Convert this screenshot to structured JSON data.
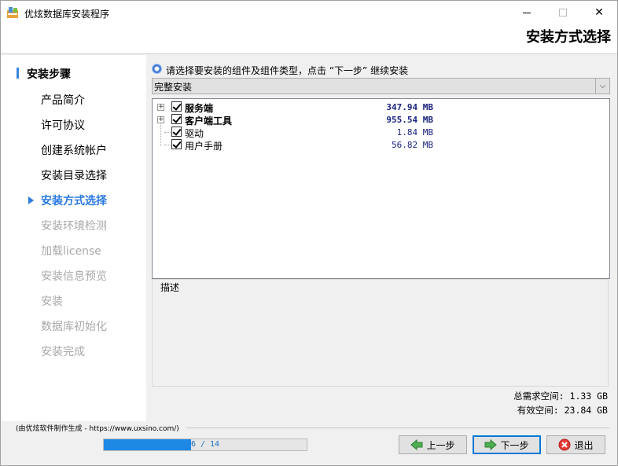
{
  "window": {
    "title": "优炫数据库安装程序",
    "header_title": "安装方式选择"
  },
  "sidebar": {
    "heading": "安装步骤",
    "steps": [
      {
        "label": "产品简介",
        "state": "done"
      },
      {
        "label": "许可协议",
        "state": "done"
      },
      {
        "label": "创建系统帐户",
        "state": "done"
      },
      {
        "label": "安装目录选择",
        "state": "done"
      },
      {
        "label": "安装方式选择",
        "state": "current"
      },
      {
        "label": "安装环境检测",
        "state": "pending"
      },
      {
        "label": "加载license",
        "state": "pending"
      },
      {
        "label": "安装信息预览",
        "state": "pending"
      },
      {
        "label": "安装",
        "state": "pending"
      },
      {
        "label": "数据库初始化",
        "state": "pending"
      },
      {
        "label": "安装完成",
        "state": "pending"
      }
    ]
  },
  "main": {
    "instruction": "请选择要安装的组件及组件类型，点击 “下一步” 继续安装",
    "install_type": "完整安装",
    "components": [
      {
        "label": "服务端",
        "size": "347.94 MB",
        "checked": true,
        "expandable": true,
        "bold": true
      },
      {
        "label": "客户端工具",
        "size": "955.54 MB",
        "checked": true,
        "expandable": true,
        "bold": true
      },
      {
        "label": "驱动",
        "size": "1.84 MB",
        "checked": true,
        "expandable": false,
        "bold": false
      },
      {
        "label": "用户手册",
        "size": "56.82 MB",
        "checked": true,
        "expandable": false,
        "bold": false
      }
    ],
    "description_label": "描述",
    "required_space": "总需求空间: 1.33 GB",
    "available_space": "有效空间: 23.84 GB"
  },
  "footer": {
    "credit": "(由优炫软件制作生成 - https://www.uxsino.com/)",
    "progress_text": "6 / 14",
    "progress_fraction": 0.43,
    "prev_label": "上一步",
    "next_label": "下一步",
    "exit_label": "退出"
  },
  "colors": {
    "accent": "#2b7ae0",
    "pending_text": "#a9a9a9",
    "progress_fill": "#1e88e5",
    "size_text": "#1a237e"
  }
}
